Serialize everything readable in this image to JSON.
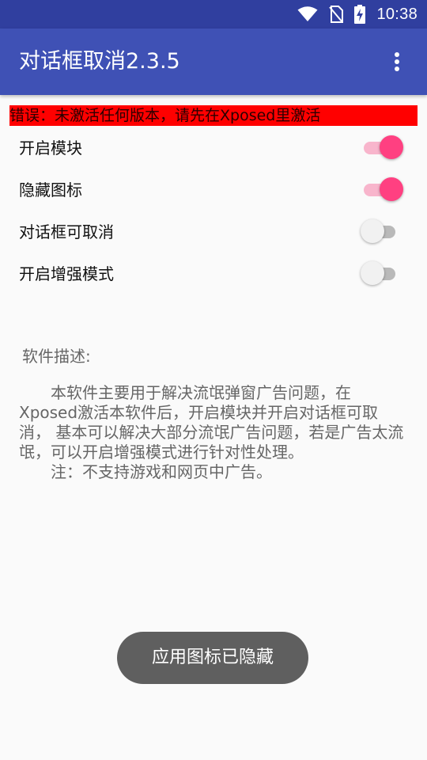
{
  "status_bar": {
    "time": "10:38",
    "icons": [
      "wifi-icon",
      "no-sim-icon",
      "battery-charging-icon"
    ]
  },
  "app_bar": {
    "title": "对话框取消2.3.5",
    "menu_icon": "more-vert-icon"
  },
  "error": {
    "text": "错误：未激活任何版本，请先在Xposed里激活",
    "color": "#ff0000"
  },
  "settings": [
    {
      "label": "开启模块",
      "enabled": true
    },
    {
      "label": "隐藏图标",
      "enabled": true
    },
    {
      "label": "对话框可取消",
      "enabled": false
    },
    {
      "label": "开启增强模式",
      "enabled": false
    }
  ],
  "description": {
    "title": "软件描述:",
    "paragraph1": "本软件主要用于解决流氓弹窗广告问题，在Xposed激活本软件后，开启模块并开启对话框可取消， 基本可以解决大部分流氓广告问题，若是广告太流氓，可以开启增强模式进行针对性处理。",
    "paragraph2": "注：不支持游戏和网页中广告。"
  },
  "toast": {
    "text": "应用图标已隐藏"
  },
  "colors": {
    "primary": "#3f51b5",
    "primary_dark": "#303f9f",
    "accent": "#ff4081"
  }
}
